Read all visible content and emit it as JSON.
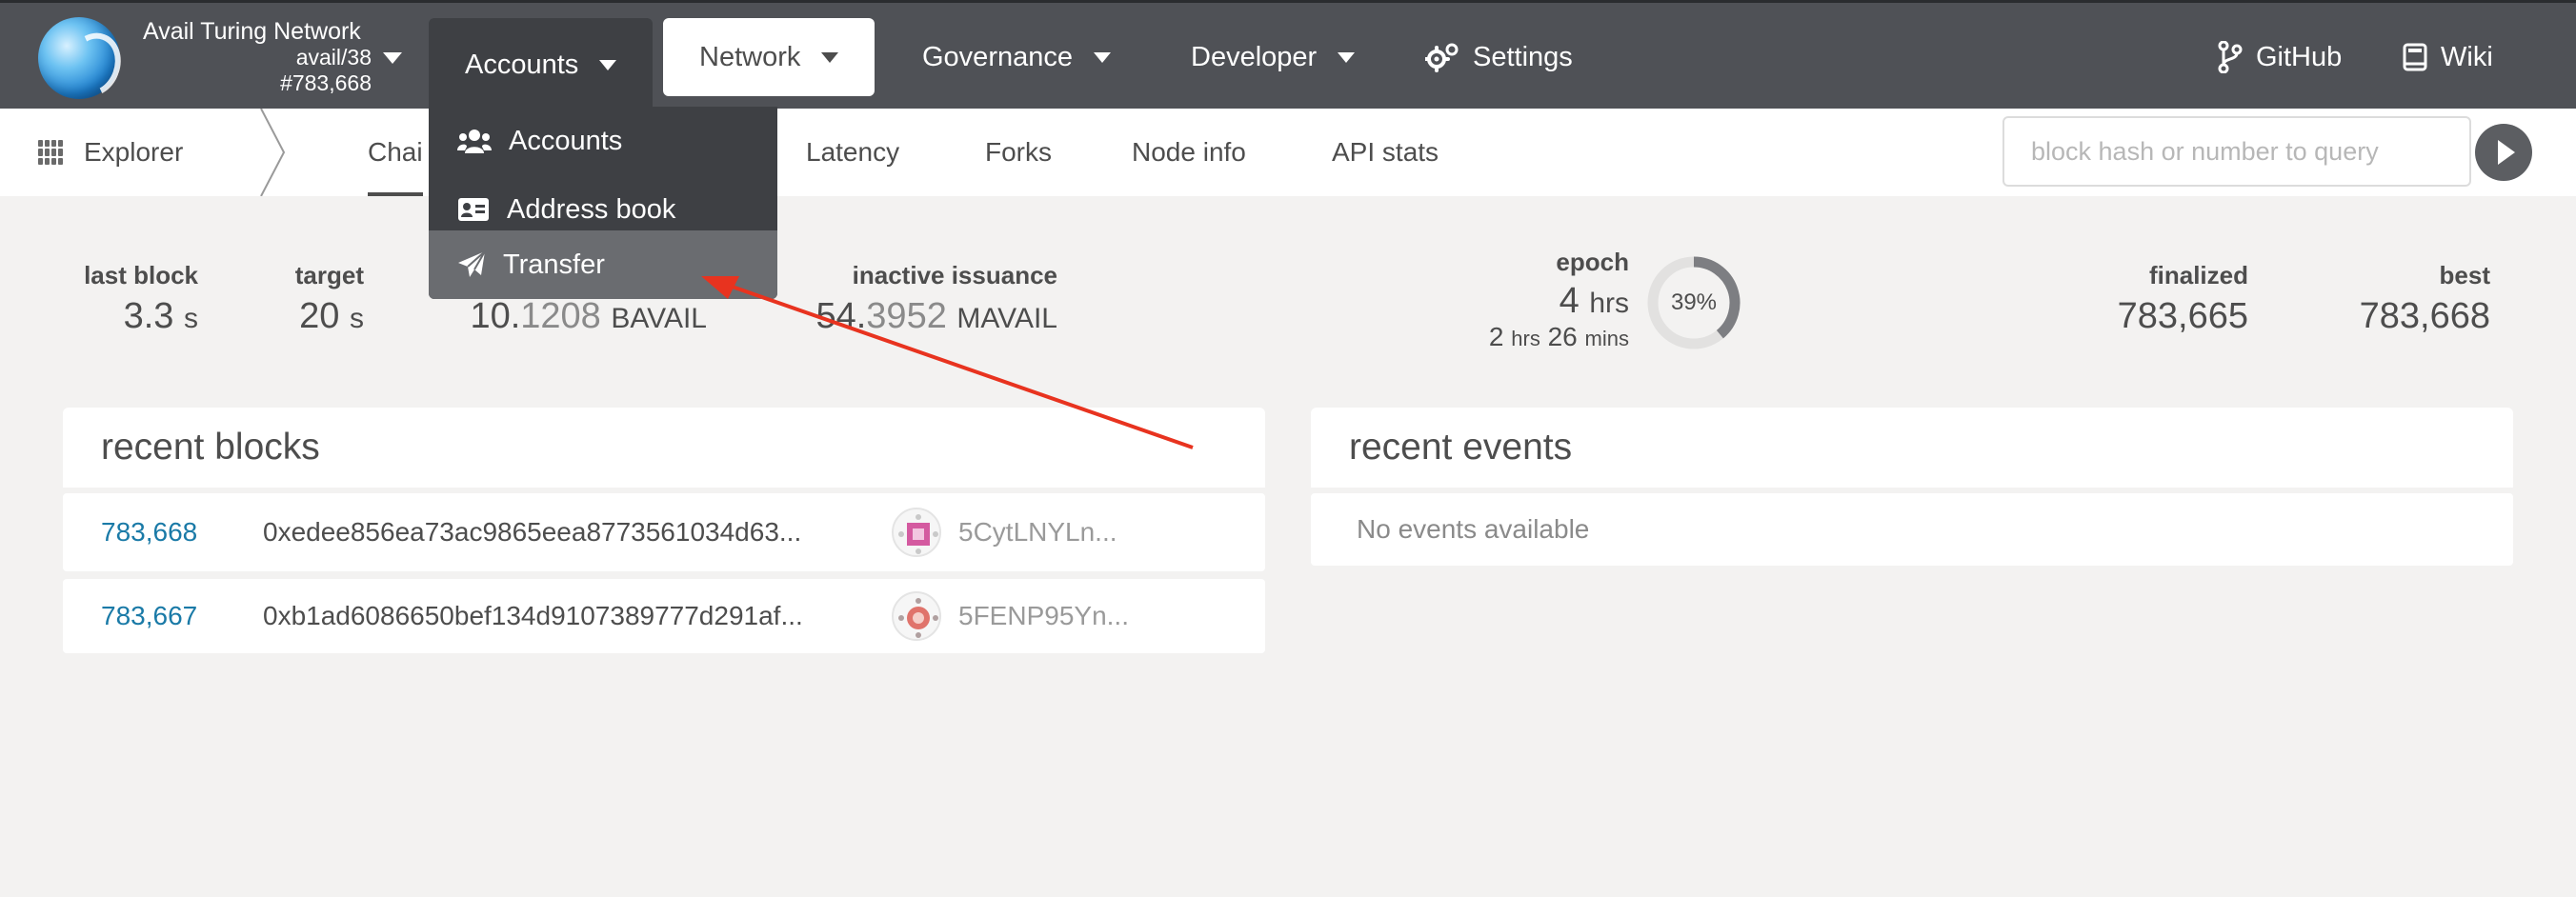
{
  "chain": {
    "name": "Avail Turing Network",
    "version": "avail/38",
    "block": "#783,668"
  },
  "nav": {
    "accounts": "Accounts",
    "network": "Network",
    "governance": "Governance",
    "developer": "Developer",
    "settings": "Settings",
    "github": "GitHub",
    "wiki": "Wiki"
  },
  "dropdown": {
    "items": [
      {
        "label": "Accounts",
        "icon": "users-icon"
      },
      {
        "label": "Address book",
        "icon": "address-card-icon"
      },
      {
        "label": "Transfer",
        "icon": "paper-plane-icon"
      }
    ],
    "highlighted": "Transfer"
  },
  "subnav": {
    "explorer": "Explorer",
    "tabs": [
      "Chain info",
      "Latency",
      "Forks",
      "Node info",
      "API stats"
    ],
    "active_tab": "Chain info",
    "visible_chain_tab_text": "Chai"
  },
  "search": {
    "placeholder": "block hash or number to query"
  },
  "stats": {
    "last_block": {
      "label": "last block",
      "value": "3.3",
      "unit": "s"
    },
    "target": {
      "label": "target",
      "value": "20",
      "unit": "s"
    },
    "total_issuance": {
      "value_int": "10.",
      "value_frac": "1208",
      "unit": "BAVAIL"
    },
    "inactive_issuance": {
      "label": "inactive issuance",
      "value_int": "54.",
      "value_frac": "3952",
      "unit": "MAVAIL"
    },
    "epoch": {
      "label": "epoch",
      "hours": "4",
      "hours_unit": "hrs",
      "remaining_hours": "2",
      "remaining_hours_unit": "hrs",
      "remaining_mins": "26",
      "remaining_mins_unit": "mins",
      "progress_percent": 39,
      "progress_label": "39%"
    },
    "finalized": {
      "label": "finalized",
      "value": "783,665"
    },
    "best": {
      "label": "best",
      "value": "783,668"
    }
  },
  "recent_blocks": {
    "title": "recent blocks",
    "rows": [
      {
        "number": "783,668",
        "hash": "0xedee856ea73ac9865eea8773561034d63...",
        "author": "5CytLNYLn..."
      },
      {
        "number": "783,667",
        "hash": "0xb1ad6086650bef134d9107389777d291af...",
        "author": "5FENP95Yn..."
      }
    ]
  },
  "recent_events": {
    "title": "recent events",
    "empty_text": "No events available"
  },
  "colors": {
    "topbar": "#4f5156",
    "dropdown": "#3e4044",
    "link": "#1a7aa7",
    "annotation_arrow": "#e8331f"
  }
}
